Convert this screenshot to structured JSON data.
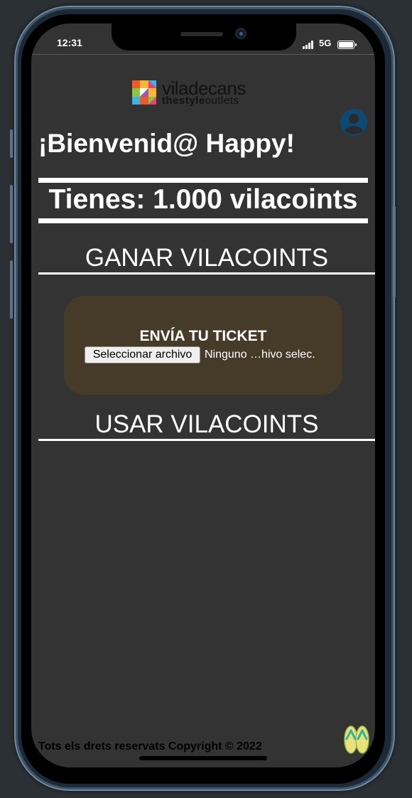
{
  "status_bar": {
    "time": "12:31",
    "network": "5G",
    "icons": [
      "signal-icon",
      "battery-icon"
    ]
  },
  "brand": {
    "title": "viladecans",
    "subtitle_bold": "thestyle",
    "subtitle_light": "outlets",
    "colors": [
      "#f05a28",
      "#f7b731",
      "#3cb4e5",
      "#8cc63f",
      "#e8417a",
      "#9b59b6"
    ]
  },
  "header": {
    "welcome": "¡Bienvenid@ Happy!",
    "balance": "Tienes: 1.000 vilacoints",
    "avatar_icon": "user-icon",
    "avatar_color": "#0d4a73"
  },
  "sections": {
    "earn_title": "GANAR VILACOINTS",
    "use_title": "USAR VILACOINTS"
  },
  "ticket": {
    "title": "ENVÍA TU TICKET",
    "file_button": "Seleccionar archivo",
    "file_status": "Ninguno …hivo selec."
  },
  "footer": {
    "copyright": "Tots els drets reservats Copyright © 2022",
    "icon": "flip-flops-icon"
  },
  "theme": {
    "background": "#333333",
    "card": "#453b28",
    "text": "#ffffff"
  }
}
